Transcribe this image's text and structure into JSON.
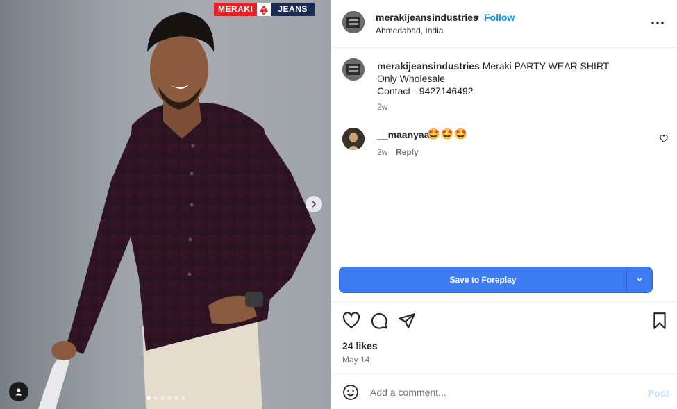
{
  "media": {
    "brand_left": "MERAKI",
    "brand_right": "JEANS",
    "carousel_total": 6,
    "carousel_active": 0
  },
  "header": {
    "username": "merakijeansindustries",
    "separator": "•",
    "follow_label": "Follow",
    "location": "Ahmedabad, India"
  },
  "caption": {
    "username": "merakijeansindustries",
    "text": " Meraki PARTY WEAR SHIRT\nOnly Wholesale\nContact - 9427146492",
    "time": "2w"
  },
  "comments": [
    {
      "username": "__maanyaa",
      "emoji": "🤩🤩🤩",
      "time": "2w",
      "reply_label": "Reply"
    }
  ],
  "save": {
    "label": "Save to Foreplay"
  },
  "stats": {
    "likes": "24 likes",
    "date": "May 14"
  },
  "add_comment": {
    "placeholder": "Add a comment...",
    "post_label": "Post"
  },
  "colors": {
    "accent": "#0095f6",
    "save_button": "#3d7bf0",
    "muted": "#737373",
    "brand_red": "#e32228",
    "brand_navy": "#1b2a53"
  }
}
